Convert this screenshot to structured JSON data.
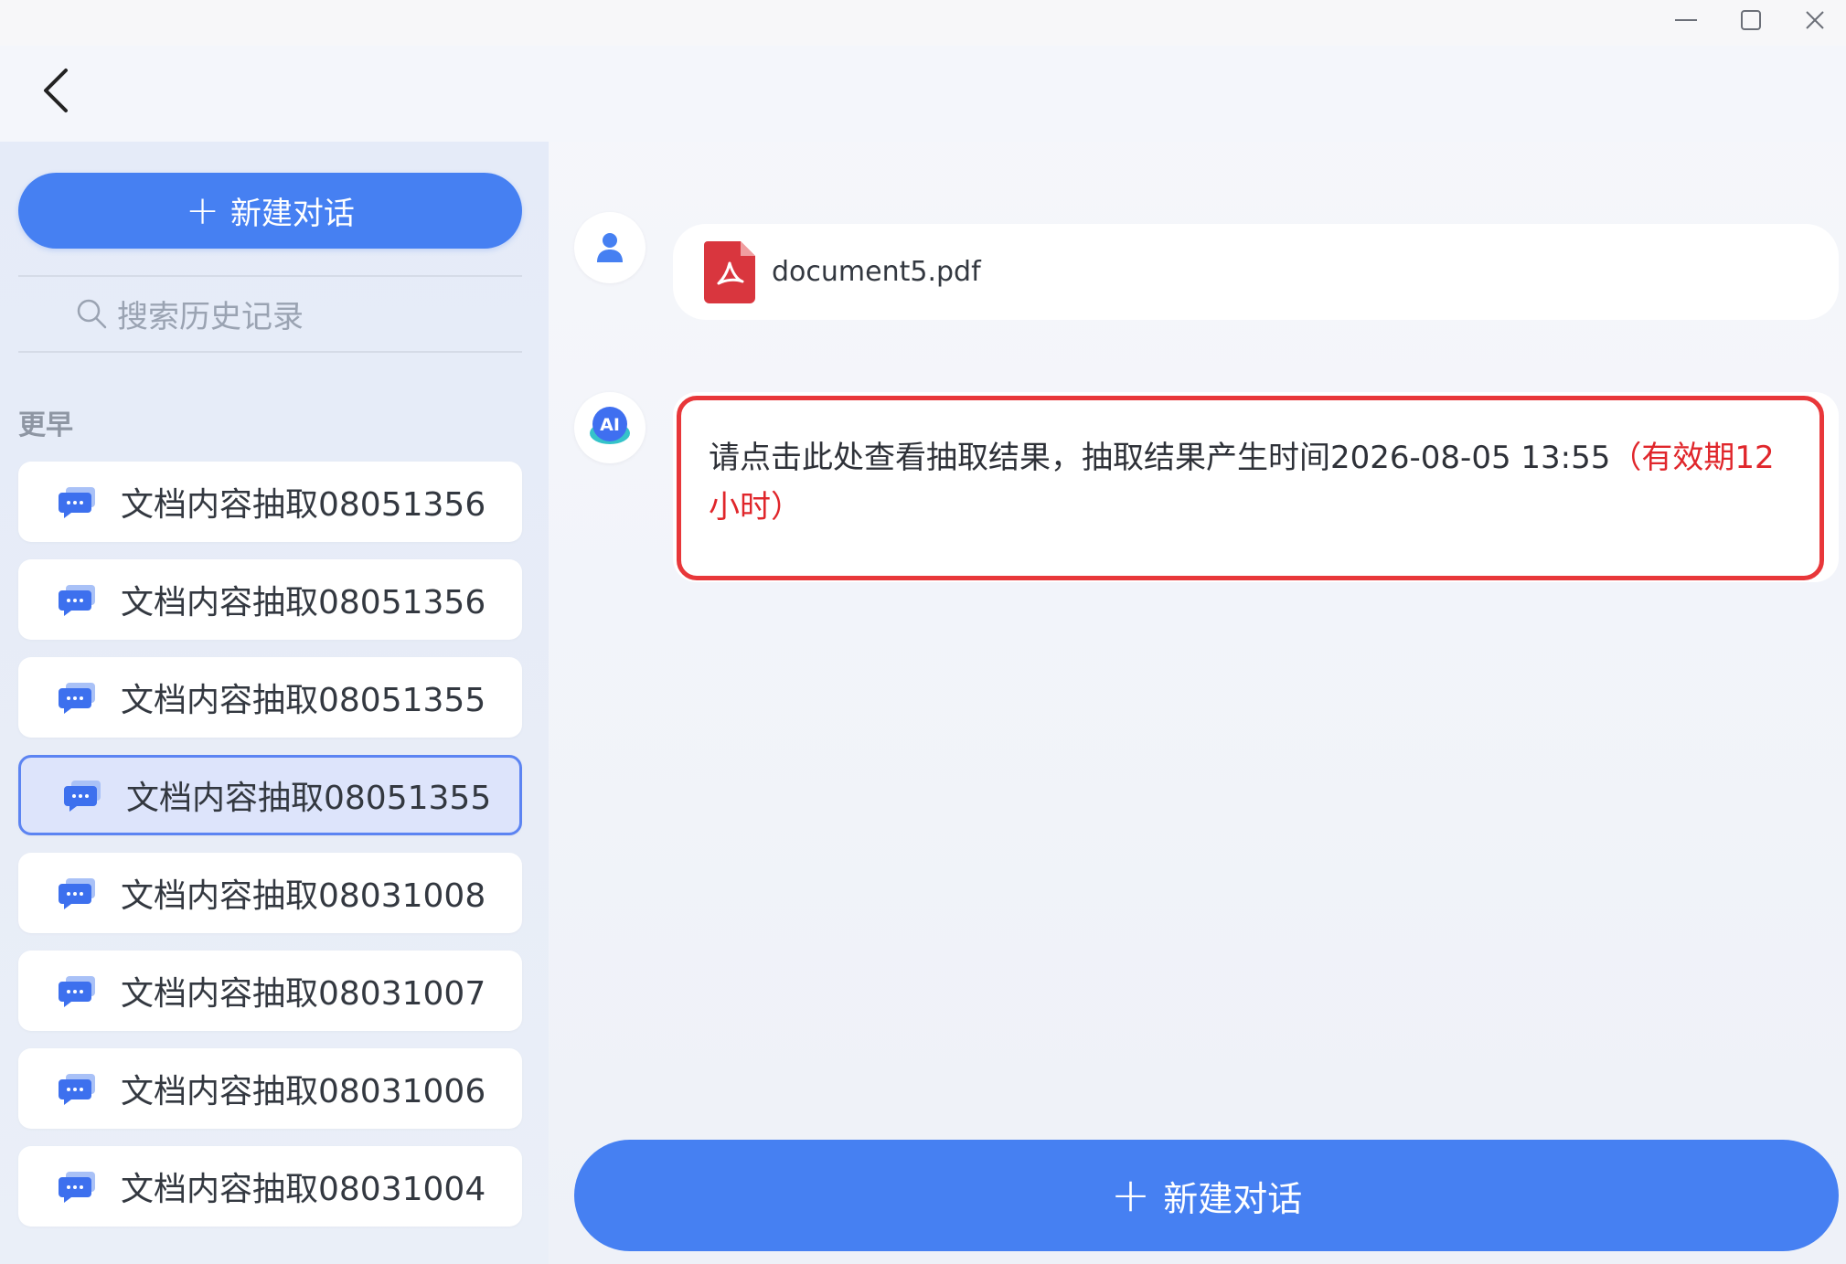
{
  "window": {
    "controls": [
      "minimize-icon",
      "maximize-icon",
      "close-icon"
    ]
  },
  "header": {
    "back_icon": "chevron-left-icon"
  },
  "sidebar": {
    "new_chat_label": "新建对话",
    "search_placeholder": "搜索历史记录",
    "section_label": "更早",
    "history": [
      {
        "title": "文档内容抽取08051356",
        "active": false
      },
      {
        "title": "文档内容抽取08051356",
        "active": false
      },
      {
        "title": "文档内容抽取08051355",
        "active": false
      },
      {
        "title": "文档内容抽取08051355",
        "active": true
      },
      {
        "title": "文档内容抽取08031008",
        "active": false
      },
      {
        "title": "文档内容抽取08031007",
        "active": false
      },
      {
        "title": "文档内容抽取08031006",
        "active": false
      },
      {
        "title": "文档内容抽取08031004",
        "active": false
      }
    ]
  },
  "chat": {
    "user_file_name": "document5.pdf",
    "ai_avatar_label": "AI",
    "ai_message_main": "请点击此处查看抽取结果，抽取结果产生时间2026-08-05 13:55",
    "ai_message_validity": "（有效期12小时）",
    "new_chat_label": "新建对话"
  },
  "colors": {
    "accent": "#4680f2",
    "highlight_border": "#e8373a",
    "validity_text": "#e0262b",
    "pdf_red": "#d9363e"
  }
}
